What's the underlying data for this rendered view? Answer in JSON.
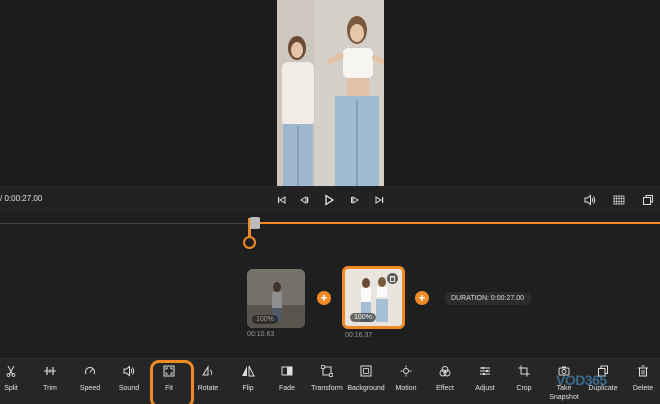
{
  "playback": {
    "timecode": "/ 0:00:27.00"
  },
  "timeline": {
    "clips": [
      {
        "volume": "100%",
        "duration": "00:10.63"
      },
      {
        "volume": "100%",
        "duration": "00:16.37"
      }
    ],
    "total_duration": "DURATION: 0:00:27.00"
  },
  "toolbar": {
    "tools": [
      {
        "label": "Split",
        "icon": "scissors-icon"
      },
      {
        "label": "Trim",
        "icon": "trim-icon"
      },
      {
        "label": "Speed",
        "icon": "speedometer-icon"
      },
      {
        "label": "Sound",
        "icon": "speaker-icon"
      },
      {
        "label": "Fit",
        "icon": "fit-icon",
        "active": true
      },
      {
        "label": "Rotate",
        "icon": "rotate-icon"
      },
      {
        "label": "Flip",
        "icon": "flip-icon"
      },
      {
        "label": "Fade",
        "icon": "fade-icon"
      },
      {
        "label": "Transform",
        "icon": "transform-icon"
      },
      {
        "label": "Background",
        "icon": "background-icon"
      },
      {
        "label": "Motion",
        "icon": "motion-icon"
      },
      {
        "label": "Effect",
        "icon": "effect-icon"
      },
      {
        "label": "Adjust",
        "icon": "sliders-icon"
      },
      {
        "label": "Crop",
        "icon": "crop-icon"
      },
      {
        "label": "Take Snapshot",
        "icon": "camera-icon"
      },
      {
        "label": "Duplicate",
        "icon": "duplicate-icon"
      },
      {
        "label": "Delete",
        "icon": "trash-icon"
      }
    ]
  },
  "watermark": "VOD365",
  "colors": {
    "accent": "#f08a24",
    "background": "#1f1f1f"
  }
}
